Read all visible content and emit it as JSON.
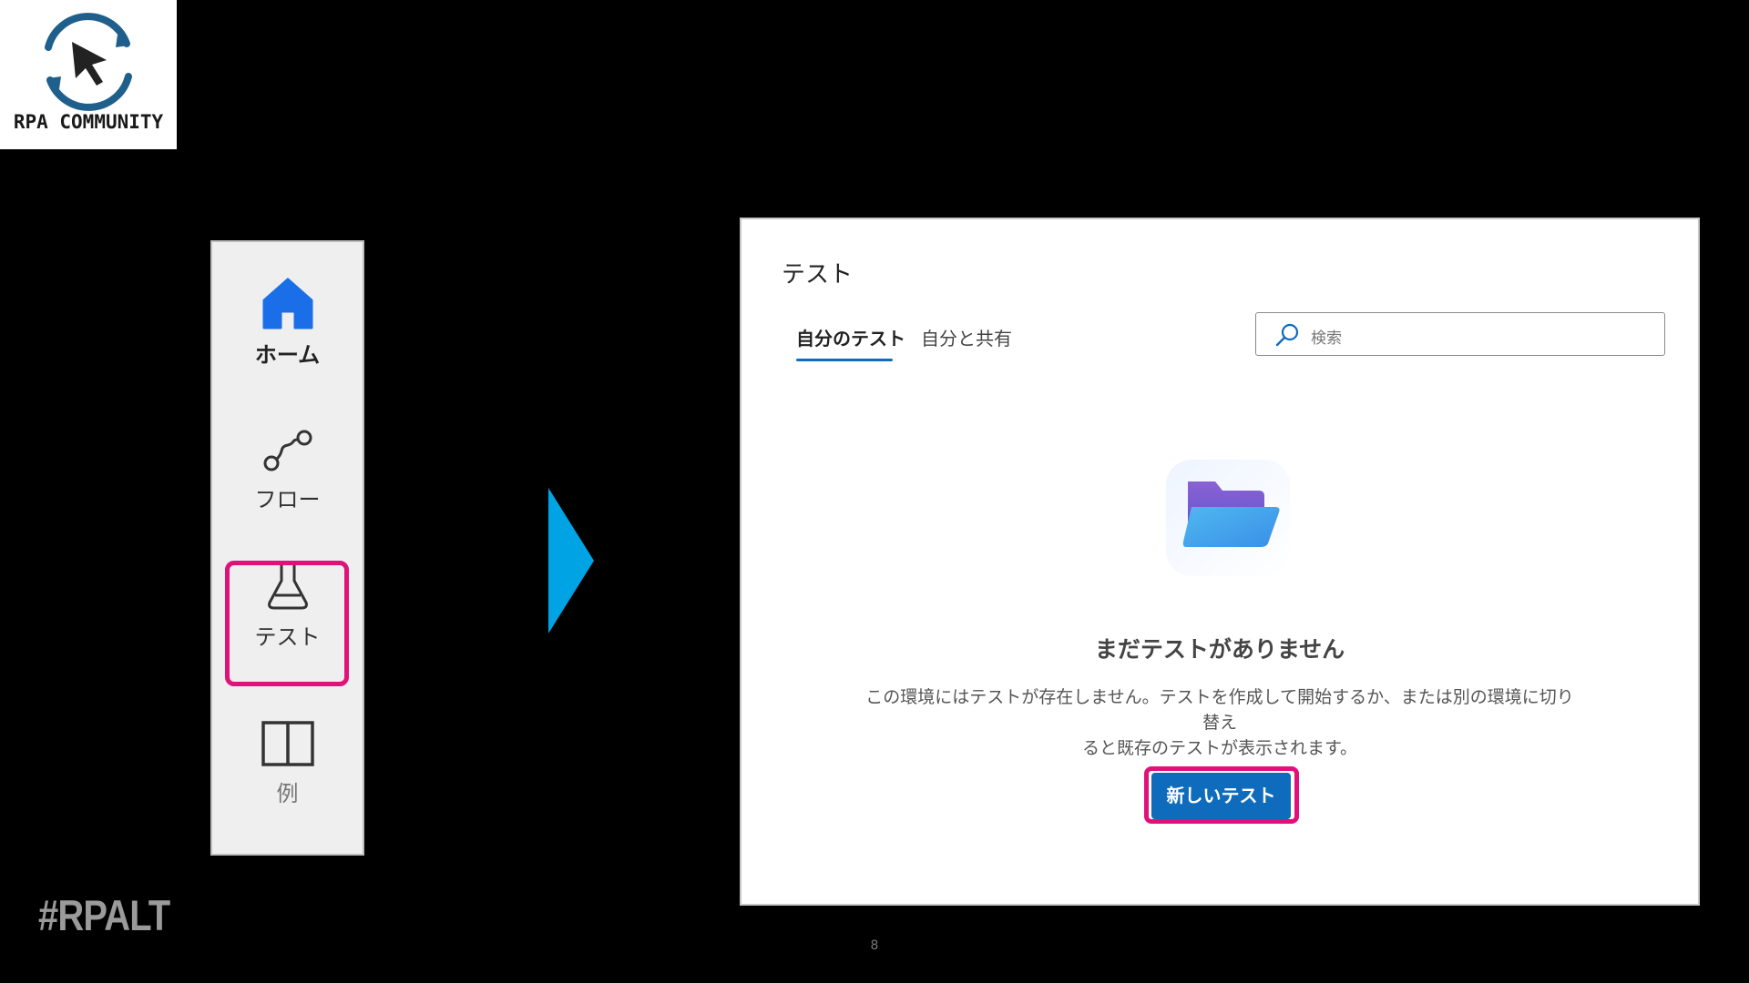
{
  "logo": {
    "text": "RPA COMMUNITY",
    "icon": "cursor-cycle-icon"
  },
  "hashtag": "#RPALT",
  "nav": {
    "items": [
      {
        "label": "ホーム",
        "icon": "home-icon"
      },
      {
        "label": "フロー",
        "icon": "flow-icon"
      },
      {
        "label": "テスト",
        "icon": "flask-icon"
      },
      {
        "label": "例",
        "icon": "book-icon"
      }
    ]
  },
  "arrow": {
    "icon": "chevron-right-icon",
    "color": "#00a4e4"
  },
  "main": {
    "title": "テスト",
    "tabs": [
      {
        "label": "自分のテスト",
        "active": true
      },
      {
        "label": "自分と共有",
        "active": false
      }
    ],
    "search": {
      "placeholder": "検索",
      "icon": "search-icon"
    },
    "empty": {
      "icon": "folder-icon",
      "title": "まだテストがありません",
      "desc_line1": "この環境にはテストが存在しません。テストを作成して開始するか、または別の環境に切り替え",
      "desc_line2": "ると既存のテストが表示されます。"
    },
    "new_button": "新しいテスト"
  },
  "highlight_color": "#e0127a",
  "accent_color": "#0f6cbd",
  "slide_number": "8"
}
